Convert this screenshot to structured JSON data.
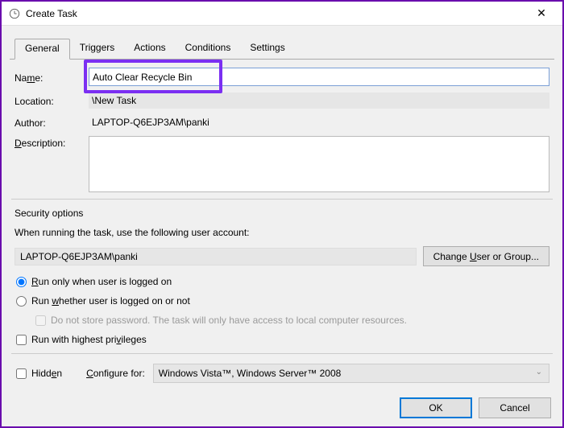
{
  "window": {
    "title": "Create Task",
    "close": "✕"
  },
  "tabs": {
    "general": "General",
    "triggers": "Triggers",
    "actions": "Actions",
    "conditions": "Conditions",
    "settings": "Settings"
  },
  "labels": {
    "name": "Name:",
    "location": "Location:",
    "author": "Author:",
    "description": "Description:",
    "security_options": "Security options",
    "when_running": "When running the task, use the following user account:",
    "change_user": "Change User or Group...",
    "run_logged_on": "Run only when user is logged on",
    "run_whether": "Run whether user is logged on or not",
    "do_not_store": "Do not store password.  The task will only have access to local computer resources.",
    "highest_priv": "Run with highest privileges",
    "hidden": "Hidden",
    "configure_for": "Configure for:",
    "ok": "OK",
    "cancel": "Cancel"
  },
  "values": {
    "name": "Auto Clear Recycle Bin",
    "location": "\\New Task",
    "author": "LAPTOP-Q6EJP3AM\\panki",
    "description": "",
    "user_account": "LAPTOP-Q6EJP3AM\\panki",
    "configure_for": "Windows Vista™, Windows Server™ 2008"
  },
  "state": {
    "run_option": "logged_on",
    "do_not_store": false,
    "highest_priv": false,
    "hidden": false
  }
}
